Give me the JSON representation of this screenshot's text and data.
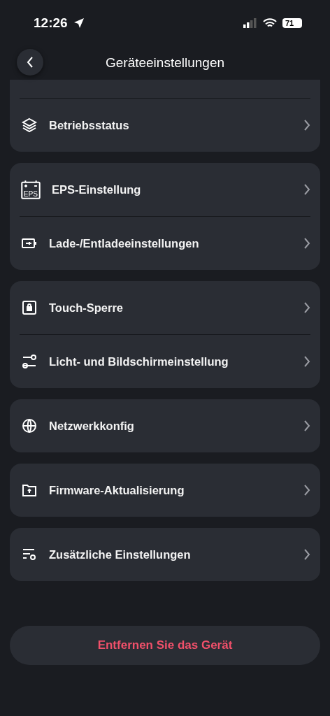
{
  "status_bar": {
    "time": "12:26",
    "battery": "71"
  },
  "header": {
    "title": "Geräteeinstellungen"
  },
  "groups": [
    {
      "partial_top": true,
      "items": [
        {
          "label": "Betriebsstatus"
        }
      ]
    },
    {
      "partial_top": false,
      "items": [
        {
          "label": "EPS-Einstellung",
          "icon_text": "EPS"
        },
        {
          "label": "Lade-/Entladeeinstellungen"
        }
      ]
    },
    {
      "partial_top": false,
      "items": [
        {
          "label": "Touch-Sperre"
        },
        {
          "label": "Licht- und Bildschirmeinstellung"
        }
      ]
    },
    {
      "partial_top": false,
      "items": [
        {
          "label": "Netzwerkkonfig"
        }
      ]
    },
    {
      "partial_top": false,
      "items": [
        {
          "label": "Firmware-Aktualisierung"
        }
      ]
    },
    {
      "partial_top": false,
      "items": [
        {
          "label": "Zusätzliche Einstellungen"
        }
      ]
    }
  ],
  "remove_button": {
    "label": "Entfernen Sie das Gerät"
  }
}
